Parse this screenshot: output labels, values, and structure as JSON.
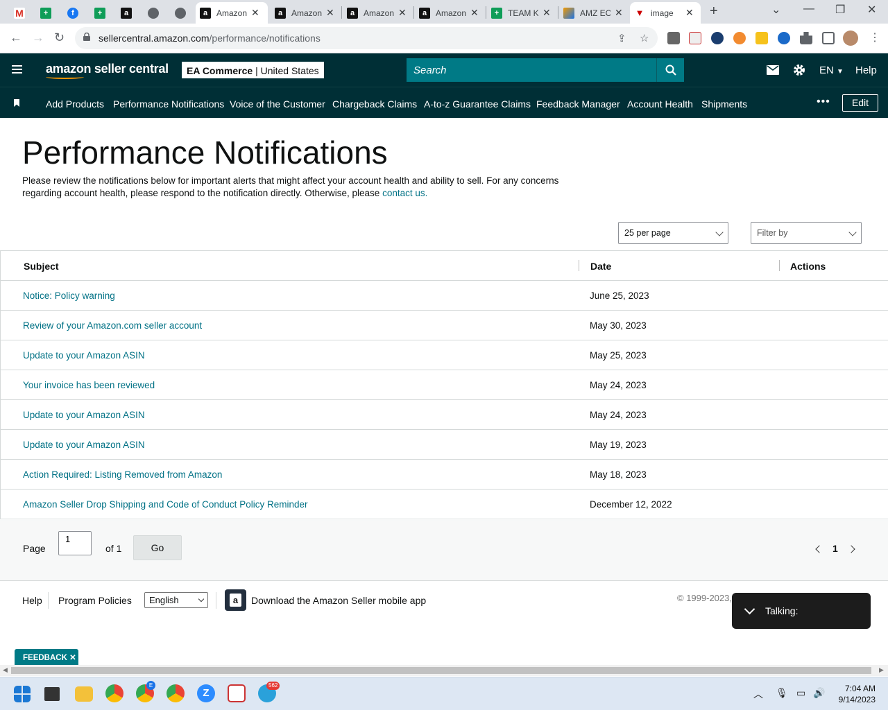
{
  "browser": {
    "tabs": [
      {
        "title": "",
        "favicon": "gmail-icon"
      },
      {
        "title": "",
        "favicon": "sheets-icon"
      },
      {
        "title": "",
        "favicon": "facebook-icon"
      },
      {
        "title": "",
        "favicon": "sheets-icon"
      },
      {
        "title": "",
        "favicon": "amazon-icon"
      },
      {
        "title": "",
        "favicon": "globe-icon"
      },
      {
        "title": "",
        "favicon": "globe-icon"
      },
      {
        "title": "Amazon",
        "favicon": "amazon-icon",
        "active": true
      },
      {
        "title": "Amazon",
        "favicon": "amazon-icon"
      },
      {
        "title": "Amazon",
        "favicon": "amazon-icon"
      },
      {
        "title": "Amazon",
        "favicon": "amazon-icon"
      },
      {
        "title": "TEAM K",
        "favicon": "sheets-icon"
      },
      {
        "title": "AMZ EC",
        "favicon": "amz-ec-icon"
      },
      {
        "title": "image",
        "favicon": "image-icon"
      }
    ],
    "url_host": "sellercentral.amazon.com",
    "url_path": "/performance/notifications"
  },
  "header": {
    "logo": "amazon seller central",
    "store_name": "EA Commerce",
    "store_region": "United States",
    "search_placeholder": "Search",
    "language": "EN",
    "help": "Help"
  },
  "nav": {
    "items": [
      "Add Products",
      "Performance Notifications",
      "Voice of the Customer",
      "Chargeback Claims",
      "A-to-z Guarantee Claims",
      "Feedback Manager",
      "Account Health",
      "Shipments"
    ],
    "more": "•••",
    "edit": "Edit"
  },
  "page": {
    "title": "Performance Notifications",
    "intro": "Please review the notifications below for important alerts that might affect your account health and ability to sell. For any concerns regarding account health, please respond to the notification directly. Otherwise, please ",
    "contact_link": "contact us.",
    "per_page": "25 per page",
    "filter": "Filter by"
  },
  "table": {
    "headers": {
      "subject": "Subject",
      "date": "Date",
      "actions": "Actions"
    },
    "rows": [
      {
        "subject": "Notice: Policy warning",
        "date": "June 25, 2023"
      },
      {
        "subject": "Review of your Amazon.com seller account",
        "date": "May 30, 2023"
      },
      {
        "subject": "Update to your Amazon ASIN",
        "date": "May 25, 2023"
      },
      {
        "subject": "Your invoice has been reviewed",
        "date": "May 24, 2023"
      },
      {
        "subject": "Update to your Amazon ASIN",
        "date": "May 24, 2023"
      },
      {
        "subject": "Update to your Amazon ASIN",
        "date": "May 19, 2023"
      },
      {
        "subject": "Action Required: Listing Removed from Amazon",
        "date": "May 18, 2023"
      },
      {
        "subject": "Amazon Seller Drop Shipping and Code of Conduct Policy Reminder",
        "date": "December 12, 2022"
      }
    ]
  },
  "pager": {
    "page_label": "Page",
    "page_value": "1",
    "of_label": "of 1",
    "go": "Go",
    "current": "1"
  },
  "footer": {
    "help": "Help",
    "policies": "Program Policies",
    "language": "English",
    "app": "Download the Amazon Seller mobile app",
    "copyright": "© 1999-2023,"
  },
  "overlay": {
    "talking": "Talking:",
    "feedback": "FEEDBACK"
  },
  "taskbar": {
    "time": "7:04 AM",
    "date": "9/14/2023",
    "telegram_badge": "562",
    "chrome_badge": "E"
  },
  "colors": {
    "header_bg": "#002f36",
    "link": "#007185",
    "search_bg": "#007a86"
  }
}
